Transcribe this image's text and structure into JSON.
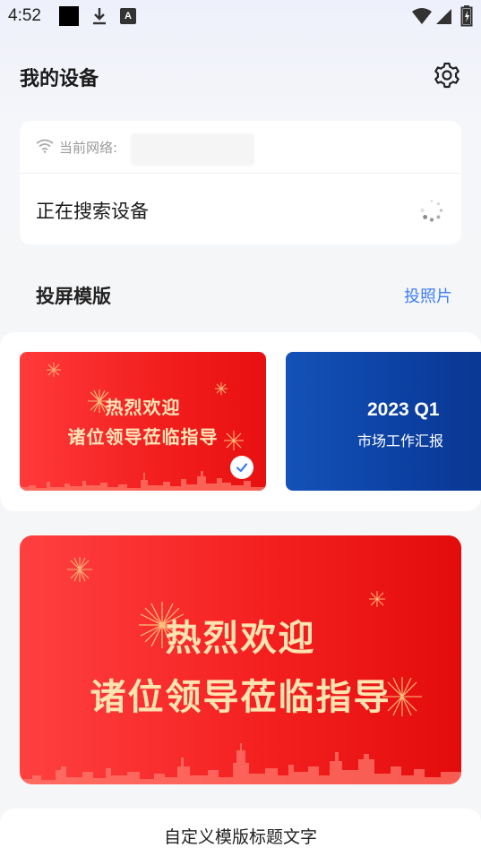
{
  "status_bar": {
    "time": "4:52",
    "icons": [
      "notification-square-icon",
      "download-icon",
      "a-icon",
      "wifi-icon",
      "signal-icon",
      "battery-icon"
    ],
    "a_letter": "A"
  },
  "header": {
    "title": "我的设备",
    "settings_icon": "gear-icon"
  },
  "device_card": {
    "network_label": "当前网络:",
    "network_value": "",
    "searching_text": "正在搜索设备"
  },
  "templates": {
    "section_title": "投屏模版",
    "photo_link": "投照片",
    "items": [
      {
        "line1": "热烈欢迎",
        "line2": "诸位领导莅临指导",
        "selected": true
      },
      {
        "year": "2023 Q1",
        "subtitle": "市场工作汇报",
        "selected": false
      }
    ]
  },
  "preview": {
    "line1": "热烈欢迎",
    "line2": "诸位领导莅临指导"
  },
  "bottom": {
    "custom_title": "自定义模版标题文字"
  },
  "colors": {
    "accent": "#3d7bf7",
    "banner_red": "#f21d1d",
    "banner_blue": "#0b3fa0",
    "banner_text": "#ffe3b0"
  }
}
